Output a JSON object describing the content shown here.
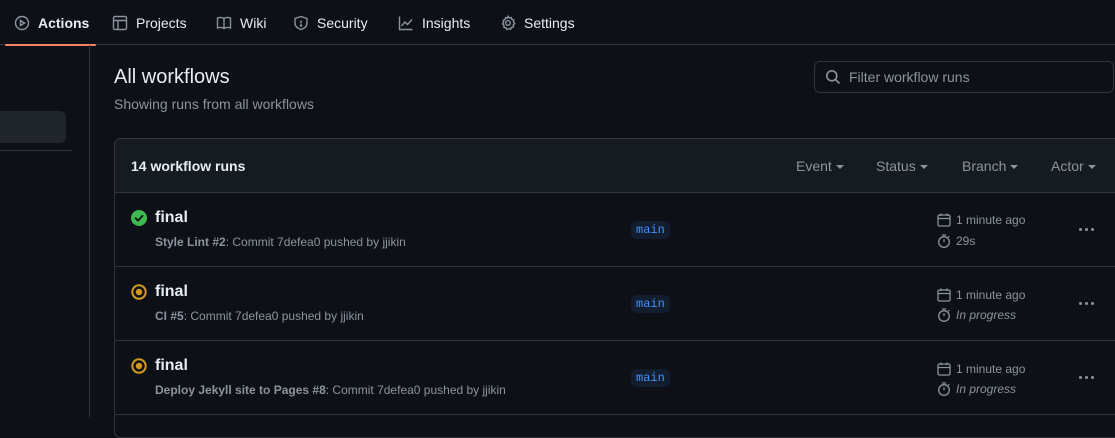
{
  "nav": {
    "tabs": [
      {
        "label": "Actions",
        "icon": "play-icon",
        "active": true
      },
      {
        "label": "Projects",
        "icon": "table-icon",
        "active": false
      },
      {
        "label": "Wiki",
        "icon": "book-icon",
        "active": false
      },
      {
        "label": "Security",
        "icon": "shield-icon",
        "active": false
      },
      {
        "label": "Insights",
        "icon": "graph-icon",
        "active": false
      },
      {
        "label": "Settings",
        "icon": "gear-icon",
        "active": false
      }
    ]
  },
  "page": {
    "title": "All workflows",
    "subtitle": "Showing runs from all workflows"
  },
  "filter": {
    "placeholder": "Filter workflow runs"
  },
  "runs_list": {
    "count_label": "14 workflow runs",
    "menus": [
      "Event",
      "Status",
      "Branch",
      "Actor"
    ],
    "runs": [
      {
        "title": "final",
        "workflow": "Style Lint #2",
        "detail": ": Commit 7defea0 pushed by jjikin",
        "branch": "main",
        "time": "1 minute ago",
        "duration": "29s",
        "status": "success"
      },
      {
        "title": "final",
        "workflow": "CI #5",
        "detail": ": Commit 7defea0 pushed by jjikin",
        "branch": "main",
        "time": "1 minute ago",
        "duration": "In progress",
        "status": "in-progress"
      },
      {
        "title": "final",
        "workflow": "Deploy Jekyll site to Pages #8",
        "detail": ": Commit 7defea0 pushed by jjikin",
        "branch": "main",
        "time": "1 minute ago",
        "duration": "In progress",
        "status": "in-progress"
      }
    ]
  },
  "colors": {
    "background": "#0d1117",
    "accent_underline": "#f78166",
    "success": "#3fb950",
    "in_progress": "#d29922",
    "branch_text": "#4493f8"
  }
}
